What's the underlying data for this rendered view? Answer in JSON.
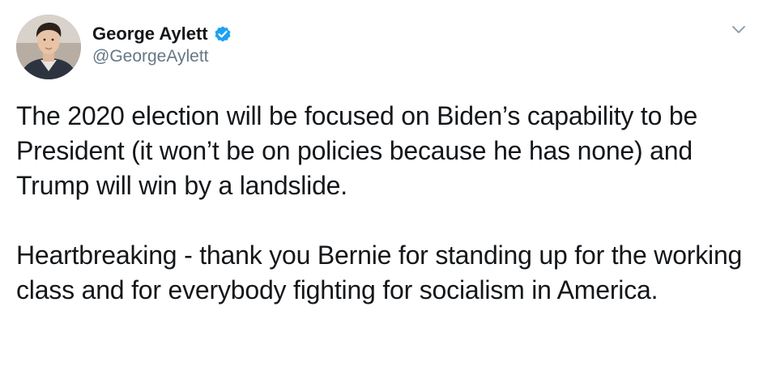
{
  "tweet": {
    "author": {
      "display_name": "George Aylett",
      "handle": "@GeorgeAylett",
      "verified": true,
      "avatar_icon": "profile-photo",
      "verified_color": "#1da1f2"
    },
    "menu_icon": "chevron-down-icon",
    "paragraphs": [
      "The 2020 election will be focused on Biden’s capability to be President (it won’t be on policies because he has none) and Trump will win by a landslide.",
      "Heartbreaking - thank you Bernie for standing up for the working class and for everybody fighting for socialism in America."
    ]
  },
  "colors": {
    "text": "#14171a",
    "secondary_text": "#657786",
    "accent": "#1da1f2",
    "background": "#ffffff"
  }
}
